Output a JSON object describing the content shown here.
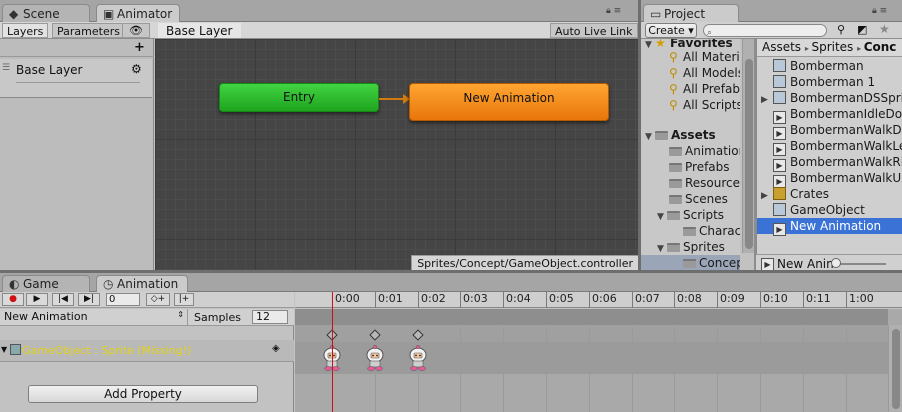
{
  "top_tabs": {
    "scene": "Scene",
    "animator": "Animator",
    "project": "Project"
  },
  "animator": {
    "layers_tab": "Layers",
    "parameters_tab": "Parameters",
    "breadcrumb": "Base Layer",
    "auto_live_link": "Auto Live Link",
    "layer_name": "Base Layer",
    "entry_node": "Entry",
    "state_node": "New Animation",
    "controller_path": "Sprites/Concept/GameObject.controller"
  },
  "project": {
    "create_label": "Create",
    "favorites_label": "Favorites",
    "favorites": [
      "All Materi",
      "All Models",
      "All Prefab",
      "All Scripts"
    ],
    "assets_label": "Assets",
    "folders": [
      "Animation",
      "Prefabs",
      "Resource",
      "Scenes",
      "Scripts",
      "Charac",
      "Sprites",
      "Concep"
    ],
    "breadcrumb": [
      "Assets",
      "Sprites",
      "Conc"
    ],
    "files": [
      {
        "name": "Bomberman",
        "icon": "sprite-icon"
      },
      {
        "name": "Bomberman 1",
        "icon": "sprite-icon"
      },
      {
        "name": "BombermanDSSprit",
        "icon": "sprite-sheet-icon"
      },
      {
        "name": "BombermanIdleDow",
        "icon": "animation-clip-icon"
      },
      {
        "name": "BombermanWalkDo",
        "icon": "animation-clip-icon"
      },
      {
        "name": "BombermanWalkLe",
        "icon": "animation-clip-icon"
      },
      {
        "name": "BombermanWalkRi",
        "icon": "animation-clip-icon"
      },
      {
        "name": "BombermanWalkUp",
        "icon": "animation-clip-icon"
      },
      {
        "name": "Crates",
        "icon": "crate-icon"
      },
      {
        "name": "GameObject",
        "icon": "controller-icon"
      },
      {
        "name": "New Animation",
        "icon": "animation-clip-icon",
        "selected": true
      }
    ],
    "footer_label": "New Anin"
  },
  "bottom_tabs": {
    "game": "Game",
    "animation": "Animation"
  },
  "animation_window": {
    "frame": "0",
    "clip_name": "New Animation",
    "samples_label": "Samples",
    "samples_value": "12",
    "property": "GameObject : Sprite (Missing!)",
    "add_property": "Add Property",
    "ruler_ticks": [
      "0:00",
      "0:01",
      "0:02",
      "0:03",
      "0:04",
      "0:05",
      "0:06",
      "0:07",
      "0:08",
      "0:09",
      "0:10",
      "0:11",
      "1:00"
    ]
  },
  "colors": {
    "entry": "#2fbf2f",
    "state": "#f38a14",
    "selection": "#3a72d6",
    "missing_property": "#e2d21a",
    "playhead": "#d01010"
  }
}
